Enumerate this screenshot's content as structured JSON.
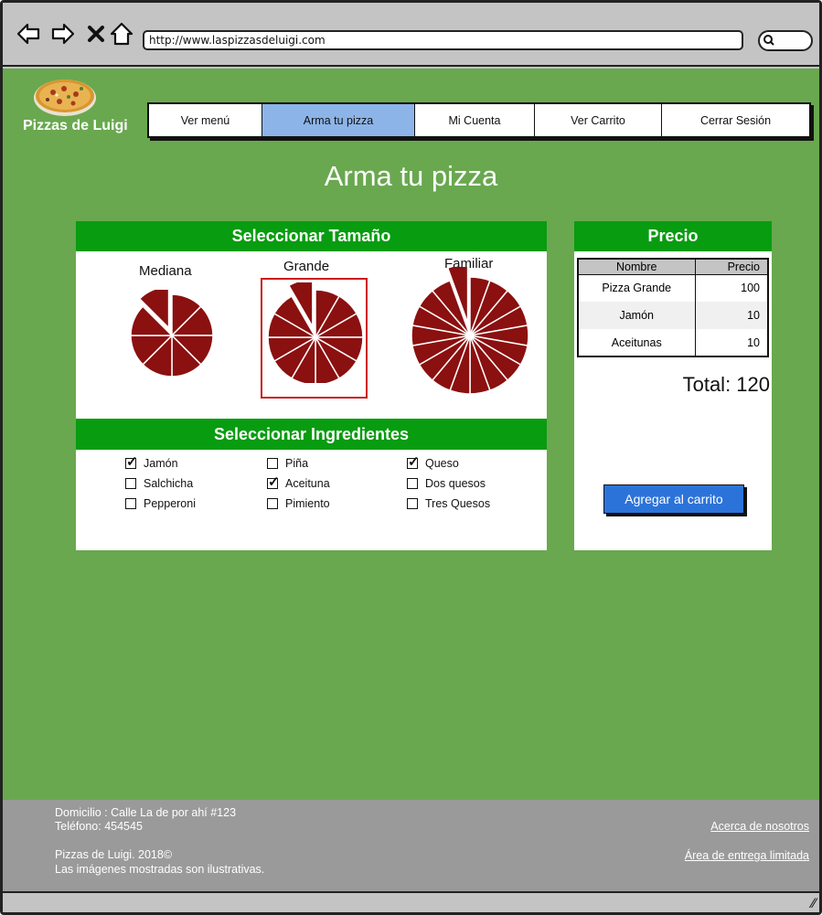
{
  "browser": {
    "url": "http://www.laspizzasdeluigi.com",
    "icons": [
      "back-arrow-icon",
      "forward-arrow-icon",
      "close-icon",
      "home-icon",
      "search-icon"
    ]
  },
  "brand": {
    "name": "Pizzas de Luigi"
  },
  "nav": {
    "items": [
      {
        "label": "Ver menú"
      },
      {
        "label": "Arma tu pizza"
      },
      {
        "label": "Mi Cuenta"
      },
      {
        "label": "Ver Carrito"
      },
      {
        "label": "Cerrar Sesión"
      }
    ],
    "active": "Arma tu pizza"
  },
  "page": {
    "title": "Arma tu pizza"
  },
  "size_panel": {
    "title": "Seleccionar Tamaño",
    "sizes": [
      {
        "label": "Mediana",
        "selected": false
      },
      {
        "label": "Grande",
        "selected": true
      },
      {
        "label": "Familiar",
        "selected": false
      }
    ]
  },
  "ingredients_panel": {
    "title": "Seleccionar Ingredientes",
    "items": [
      {
        "label": "Jamón",
        "checked": true
      },
      {
        "label": "Piña",
        "checked": false
      },
      {
        "label": "Queso",
        "checked": true
      },
      {
        "label": "Salchicha",
        "checked": false
      },
      {
        "label": "Aceituna",
        "checked": true
      },
      {
        "label": "Dos quesos",
        "checked": false
      },
      {
        "label": "Pepperoni",
        "checked": false
      },
      {
        "label": "Pimiento",
        "checked": false
      },
      {
        "label": "Tres Quesos",
        "checked": false
      }
    ]
  },
  "price_panel": {
    "title": "Precio",
    "columns": [
      "Nombre",
      "Precio"
    ],
    "rows": [
      {
        "name": "Pizza Grande",
        "price": "100"
      },
      {
        "name": "Jamón",
        "price": "10"
      },
      {
        "name": "Aceitunas",
        "price": "10"
      }
    ],
    "total": "Total: 120",
    "add_button": "Agregar al carrito"
  },
  "footer": {
    "address": "Domicilio : Calle La de por ahí #123",
    "phone": "Teléfono: 454545",
    "copyright": "Pizzas de Luigi. 2018©",
    "disclaimer": "Las imágenes mostradas son ilustrativas.",
    "link_about": "Acerca de nosotros",
    "link_delivery": "Área de entrega limitada"
  },
  "colors": {
    "background": "#69a84f",
    "panel_header": "#089c10",
    "active_tab": "#8db4e8",
    "pizza": "#8b1010",
    "selection": "#cc1a1a",
    "button": "#2c73d9",
    "footer": "#9a9a9a"
  }
}
